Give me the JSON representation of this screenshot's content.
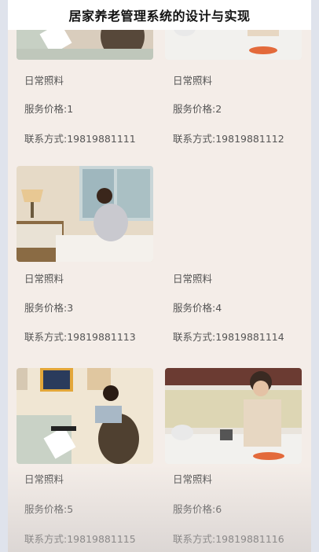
{
  "header": {
    "title": "居家养老管理系统的设计与实现"
  },
  "cards": [
    {
      "category": "日常照料",
      "price": "服务价格:1",
      "contact": "联系方式:19819881111",
      "image": "cleaning-photo"
    },
    {
      "category": "日常照料",
      "price": "服务价格:2",
      "contact": "联系方式:19819881112",
      "image": "cooking-photo"
    },
    {
      "category": "日常照料",
      "price": "服务价格:3",
      "contact": "联系方式:19819881113",
      "image": "bedmaking-photo"
    },
    {
      "category": "日常照料",
      "price": "服务价格:4",
      "contact": "联系方式:19819881114",
      "image": "none"
    },
    {
      "category": "日常照料",
      "price": "服务价格:5",
      "contact": "联系方式:19819881115",
      "image": "cleaning-photo"
    },
    {
      "category": "日常照料",
      "price": "服务价格:6",
      "contact": "联系方式:19819881116",
      "image": "cooking-photo"
    }
  ]
}
